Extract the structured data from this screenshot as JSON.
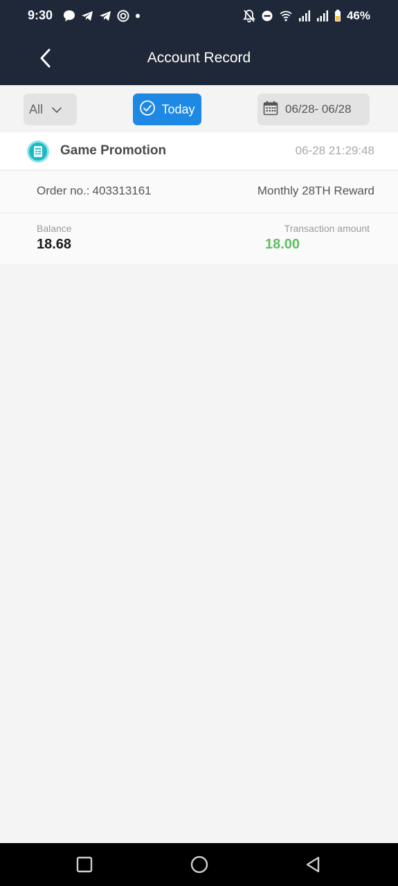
{
  "status_bar": {
    "time": "9:30",
    "battery": "46%",
    "left_icons": [
      "chat-bubble-icon",
      "telegram-icon",
      "telegram-icon",
      "target-icon",
      "dot-icon"
    ],
    "right_icons": [
      "bell-off-icon",
      "do-not-disturb-icon",
      "wifi-icon",
      "signal-icon",
      "signal-icon",
      "battery-icon"
    ]
  },
  "header": {
    "title": "Account Record",
    "back_icon": "chevron-left-icon"
  },
  "filters": {
    "type_selected": "All",
    "today_label": "Today",
    "date_range": "06/28- 06/28"
  },
  "records": [
    {
      "type": "Game Promotion",
      "datetime": "06-28 21:29:48",
      "order_label": "Order no.:",
      "order_no": "403313161",
      "description": "Monthly 28TH Reward",
      "balance_label": "Balance",
      "balance": "18.68",
      "amount_label": "Transaction amount",
      "amount": "18.00"
    }
  ],
  "colors": {
    "header_bg": "#1f2838",
    "accent": "#1e88e5",
    "amount_positive": "#5fbf5f",
    "page_bg": "#f4f4f4"
  },
  "navbar": {
    "buttons": [
      "recents-square-icon",
      "home-circle-icon",
      "back-triangle-icon"
    ]
  }
}
